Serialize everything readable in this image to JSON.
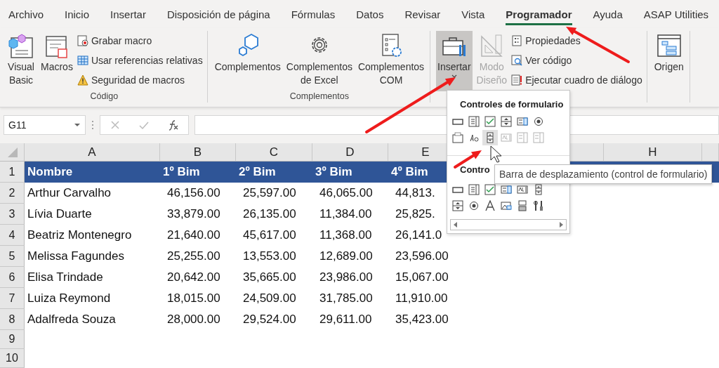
{
  "ribbon_tabs": [
    {
      "label": "Archivo",
      "selected": false
    },
    {
      "label": "Inicio",
      "selected": false
    },
    {
      "label": "Insertar",
      "selected": false
    },
    {
      "label": "Disposición de página",
      "selected": false
    },
    {
      "label": "Fórmulas",
      "selected": false
    },
    {
      "label": "Datos",
      "selected": false
    },
    {
      "label": "Revisar",
      "selected": false
    },
    {
      "label": "Vista",
      "selected": false
    },
    {
      "label": "Programador",
      "selected": true
    },
    {
      "label": "Ayuda",
      "selected": false
    },
    {
      "label": "ASAP Utilities",
      "selected": false
    }
  ],
  "ribbon_groups": [
    {
      "title": "Código",
      "large": [
        {
          "kind": "visual_basic",
          "lines": [
            "Visual",
            "Basic"
          ],
          "pressed": false,
          "disabled": false,
          "has_menu": false
        },
        {
          "kind": "macros",
          "lines": [
            "Macros"
          ],
          "pressed": false,
          "disabled": false,
          "has_menu": false
        }
      ],
      "small": [
        {
          "kind": "record",
          "label": "Grabar macro"
        },
        {
          "kind": "relative",
          "label": "Usar referencias relativas"
        },
        {
          "kind": "warning",
          "label": "Seguridad de macros"
        }
      ]
    },
    {
      "title": "Complementos",
      "large": [
        {
          "kind": "addins",
          "lines": [
            "Complementos"
          ],
          "pressed": false,
          "disabled": false,
          "has_menu": false
        },
        {
          "kind": "gear",
          "lines": [
            "Complementos",
            "de Excel"
          ],
          "pressed": false,
          "disabled": false,
          "has_menu": false
        },
        {
          "kind": "com",
          "lines": [
            "Complementos",
            "COM"
          ],
          "pressed": false,
          "disabled": false,
          "has_menu": false
        }
      ]
    },
    {
      "large": [
        {
          "kind": "toolbox",
          "lines": [
            "Insertar"
          ],
          "pressed": true,
          "disabled": false,
          "has_menu": true
        },
        {
          "kind": "design",
          "lines": [
            "Modo",
            "Diseño"
          ],
          "pressed": false,
          "disabled": true,
          "has_menu": false
        }
      ],
      "small": [
        {
          "kind": "properties",
          "label": "Propiedades"
        },
        {
          "kind": "view_code",
          "label": "Ver código"
        },
        {
          "kind": "run_dialog",
          "label": "Ejecutar cuadro de diálogo"
        }
      ]
    },
    {
      "large": [
        {
          "kind": "source",
          "lines": [
            "Origen"
          ],
          "pressed": false,
          "disabled": false,
          "has_menu": false
        }
      ]
    }
  ],
  "formula_bar": {
    "name_box": "G11"
  },
  "sheet": {
    "columns": [
      {
        "label": "A"
      },
      {
        "label": "B"
      },
      {
        "label": "C"
      },
      {
        "label": "D"
      },
      {
        "label": "E"
      },
      {},
      {},
      {
        "label": "H"
      },
      {}
    ],
    "rows": [
      {
        "number": "1",
        "kind": "header",
        "cells": [
          "Nombre",
          "1º Bim",
          "2º Bim",
          "3º Bim",
          "4º Bim"
        ]
      },
      {
        "number": "2",
        "kind": "data",
        "cells": [
          "Arthur Carvalho",
          "46,156.00",
          "25,597.00",
          "46,065.00",
          "44,813."
        ]
      },
      {
        "number": "3",
        "kind": "data",
        "cells": [
          "Lívia Duarte",
          "33,879.00",
          "26,135.00",
          "11,384.00",
          "25,825."
        ]
      },
      {
        "number": "4",
        "kind": "data",
        "cells": [
          "Beatriz Montenegro",
          "21,640.00",
          "45,617.00",
          "11,368.00",
          "26,141.0"
        ]
      },
      {
        "number": "5",
        "kind": "data",
        "cells": [
          "Melissa Fagundes",
          "25,255.00",
          "13,553.00",
          "12,689.00",
          "23,596.00"
        ]
      },
      {
        "number": "6",
        "kind": "data",
        "cells": [
          "Elisa Trindade",
          "20,642.00",
          "35,665.00",
          "23,986.00",
          "15,067.00"
        ]
      },
      {
        "number": "7",
        "kind": "data",
        "cells": [
          "Luiza Reymond",
          "18,015.00",
          "24,509.00",
          "31,785.00",
          "11,910.00"
        ]
      },
      {
        "number": "8",
        "kind": "data",
        "cells": [
          "Adalfreda Souza",
          "28,000.00",
          "29,524.00",
          "29,611.00",
          "35,423.00"
        ]
      },
      {
        "number": "9",
        "kind": "empty"
      },
      {
        "number": "10",
        "kind": "empty"
      }
    ]
  },
  "controls_menu": {
    "sections": [
      {
        "title": "Controles de formulario",
        "items": [
          {
            "kind": "button",
            "disabled": false,
            "selected": false
          },
          {
            "kind": "combo",
            "disabled": false,
            "selected": false
          },
          {
            "kind": "checkbox",
            "disabled": false,
            "selected": false
          },
          {
            "kind": "spin",
            "disabled": false,
            "selected": false
          },
          {
            "kind": "listbox",
            "disabled": false,
            "selected": false
          },
          {
            "kind": "option",
            "disabled": false,
            "selected": false
          },
          {
            "kind": "group",
            "disabled": false,
            "selected": false
          },
          {
            "kind": "label",
            "disabled": false,
            "selected": false
          },
          {
            "kind": "scrollbar",
            "disabled": false,
            "selected": true
          },
          {
            "kind": "textfield",
            "disabled": true,
            "selected": false
          },
          {
            "kind": "combolist",
            "disabled": true,
            "selected": false
          },
          {
            "kind": "combodrop",
            "disabled": true,
            "selected": false
          }
        ]
      },
      {
        "title": "Contro",
        "items": [
          {
            "kind": "button",
            "disabled": false,
            "selected": false
          },
          {
            "kind": "combo",
            "disabled": false,
            "selected": false
          },
          {
            "kind": "checkbox",
            "disabled": false,
            "selected": false
          },
          {
            "kind": "listbox",
            "disabled": false,
            "selected": false
          },
          {
            "kind": "textfield",
            "disabled": false,
            "selected": false
          },
          {
            "kind": "vscroll",
            "disabled": false,
            "selected": false
          },
          {
            "kind": "spin",
            "disabled": false,
            "selected": false
          },
          {
            "kind": "option",
            "disabled": false,
            "selected": false
          },
          {
            "kind": "biglabel",
            "disabled": false,
            "selected": false
          },
          {
            "kind": "image",
            "disabled": false,
            "selected": false
          },
          {
            "kind": "toggle",
            "disabled": false,
            "selected": false
          },
          {
            "kind": "more",
            "disabled": false,
            "selected": false
          }
        ]
      }
    ]
  },
  "tooltip": "Barra de desplazamiento (control de formulario)"
}
